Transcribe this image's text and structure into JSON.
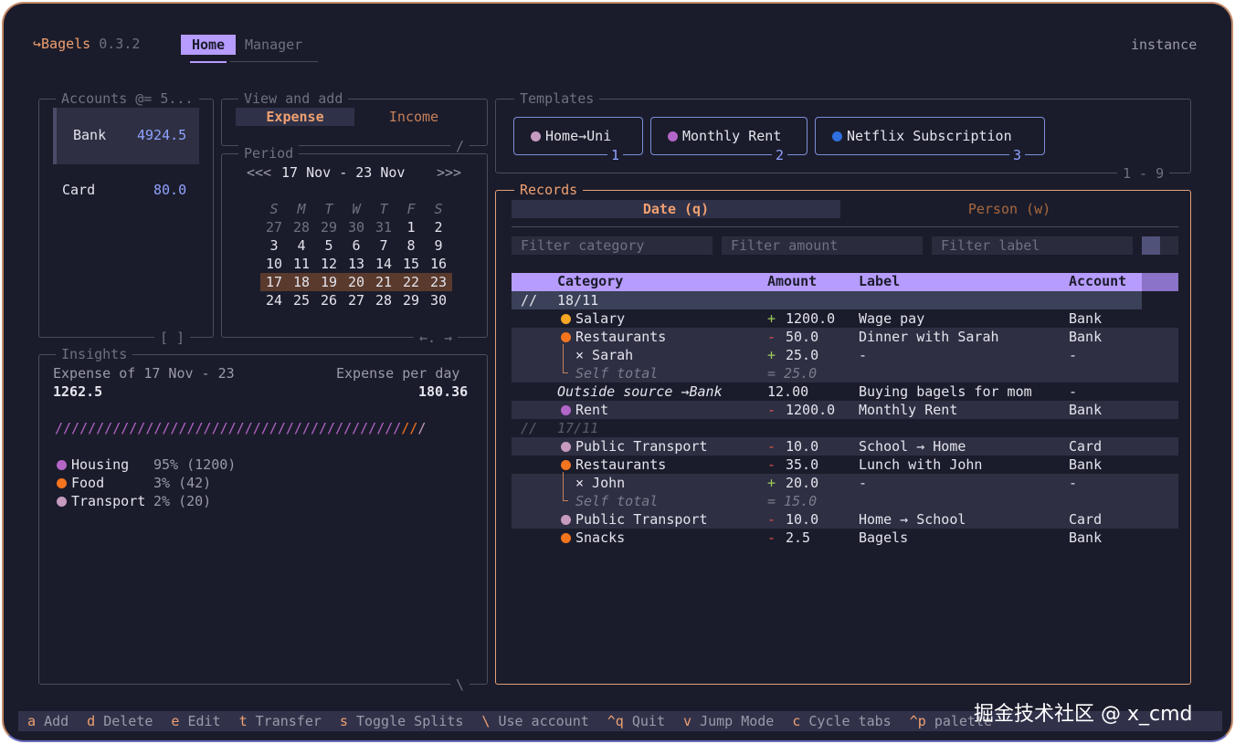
{
  "app": {
    "name": "Bagels",
    "version": "0.3.2",
    "instance_label": "instance"
  },
  "tabs": [
    {
      "label": "Home",
      "active": true
    },
    {
      "label": "Manager",
      "active": false
    }
  ],
  "accounts": {
    "title": "Accounts @= 5...",
    "items": [
      {
        "name": "Bank",
        "balance": "4924.5",
        "selected": true
      },
      {
        "name": "Card",
        "balance": "80.0",
        "selected": false
      }
    ],
    "footer": "[ ]"
  },
  "view_add": {
    "title": "View and add",
    "expense_label": "Expense",
    "income_label": "Income",
    "corner": "/"
  },
  "period": {
    "title": "Period",
    "prev": "<<<",
    "next": ">>>",
    "range": "17 Nov - 23 Nov",
    "weekday_headers": [
      "S",
      "M",
      "T",
      "W",
      "T",
      "F",
      "S"
    ],
    "weeks": [
      [
        "27",
        "28",
        "29",
        "30",
        "31",
        "1",
        "2"
      ],
      [
        "3",
        "4",
        "5",
        "6",
        "7",
        "8",
        "9"
      ],
      [
        "10",
        "11",
        "12",
        "13",
        "14",
        "15",
        "16"
      ],
      [
        "17",
        "18",
        "19",
        "20",
        "21",
        "22",
        "23"
      ],
      [
        "24",
        "25",
        "26",
        "27",
        "28",
        "29",
        "30"
      ]
    ],
    "footer": "←. →"
  },
  "insights": {
    "title": "Insights",
    "expense_of_label": "Expense of 17 Nov - 23",
    "expense_value": "1262.5",
    "per_day_label": "Expense per day",
    "per_day_value": "180.36",
    "bar_main": "//////////////////////////////////////////",
    "bar_tail": "//",
    "bar_end": "/",
    "categories": [
      {
        "name": "Housing",
        "pct": "95% (1200)",
        "color": "#b366c8"
      },
      {
        "name": "Food",
        "pct": "3% (42)",
        "color": "#f5741e"
      },
      {
        "name": "Transport",
        "pct": "2% (20)",
        "color": "#c79ac0"
      }
    ],
    "corner": "\\"
  },
  "templates": {
    "title": "Templates",
    "items": [
      {
        "label": "Home→Uni",
        "num": "1",
        "color": "#c79ac0"
      },
      {
        "label": "Monthly Rent",
        "num": "2",
        "color": "#b366c8"
      },
      {
        "label": "Netflix Subscription",
        "num": "3",
        "color": "#2f6fe0"
      }
    ],
    "range": "1 - 9"
  },
  "records": {
    "title": "Records",
    "tab_date": "Date (q)",
    "tab_person": "Person (w)",
    "filter_category": "Filter category",
    "filter_amount": "Filter amount",
    "filter_label": "Filter label",
    "headers": {
      "category": "Category",
      "amount": "Amount",
      "label": "Label",
      "account": "Account"
    },
    "rows": [
      {
        "type": "date",
        "prefix": "//",
        "text": "18/11",
        "selected": true
      },
      {
        "type": "rec",
        "dot": "#f5a623",
        "category": "Salary",
        "sign": "+",
        "amount": "1200.0",
        "label": "Wage pay",
        "account": "Bank"
      },
      {
        "type": "rec",
        "dot": "#f5741e",
        "category": "Restaurants",
        "sign": "-",
        "amount": "50.0",
        "label": "Dinner with Sarah",
        "account": "Bank"
      },
      {
        "type": "split",
        "category": "× Sarah",
        "sign": "+",
        "amount": "25.0",
        "label": "-",
        "account": "-"
      },
      {
        "type": "self",
        "category": "Self total",
        "amount": "= 25.0"
      },
      {
        "type": "transfer",
        "category": "Outside source →Bank",
        "amount": "12.00",
        "label": "Buying bagels for mom",
        "account": "-"
      },
      {
        "type": "rec",
        "dot": "#b366c8",
        "category": "Rent",
        "sign": "-",
        "amount": "1200.0",
        "label": "Monthly Rent",
        "account": "Bank"
      },
      {
        "type": "date",
        "prefix": "//",
        "text": "17/11",
        "selected": false
      },
      {
        "type": "rec",
        "dot": "#c79ac0",
        "category": "Public Transport",
        "sign": "-",
        "amount": "10.0",
        "label": "School → Home",
        "account": "Card"
      },
      {
        "type": "rec",
        "dot": "#f5741e",
        "category": "Restaurants",
        "sign": "-",
        "amount": "35.0",
        "label": "Lunch with John",
        "account": "Bank"
      },
      {
        "type": "split",
        "category": "× John",
        "sign": "+",
        "amount": "20.0",
        "label": "-",
        "account": "-"
      },
      {
        "type": "self",
        "category": "Self total",
        "amount": "= 15.0"
      },
      {
        "type": "rec",
        "dot": "#c79ac0",
        "category": "Public Transport",
        "sign": "-",
        "amount": "10.0",
        "label": "Home → School",
        "account": "Card"
      },
      {
        "type": "rec",
        "dot": "#f5741e",
        "category": "Snacks",
        "sign": "-",
        "amount": "2.5",
        "label": "Bagels",
        "account": "Bank"
      }
    ]
  },
  "footer": {
    "shortcuts": [
      {
        "key": "a",
        "label": "Add"
      },
      {
        "key": "d",
        "label": "Delete"
      },
      {
        "key": "e",
        "label": "Edit"
      },
      {
        "key": "t",
        "label": "Transfer"
      },
      {
        "key": "s",
        "label": "Toggle Splits"
      },
      {
        "key": "\\",
        "label": "Use account"
      },
      {
        "key": "^q",
        "label": "Quit"
      },
      {
        "key": "v",
        "label": "Jump Mode"
      },
      {
        "key": "c",
        "label": "Cycle tabs"
      },
      {
        "key": "^p",
        "label": "palette"
      }
    ]
  },
  "watermark": "掘金技术社区 @ x_cmd"
}
